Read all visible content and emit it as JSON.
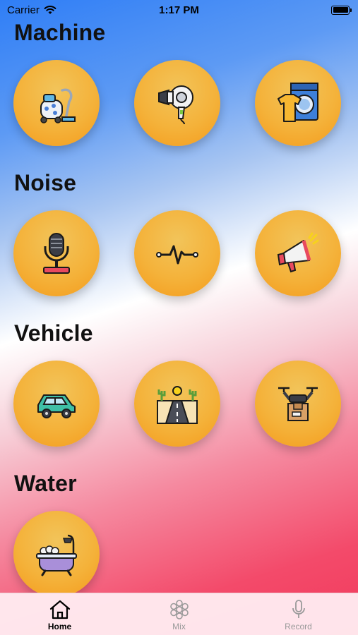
{
  "status_bar": {
    "carrier": "Carrier",
    "time": "1:17 PM"
  },
  "sections": [
    {
      "title": "Machine",
      "items": [
        "vacuum-cleaner-icon",
        "hair-dryer-icon",
        "washing-machine-icon"
      ]
    },
    {
      "title": "Noise",
      "items": [
        "microphone-icon",
        "heartbeat-icon",
        "megaphone-icon"
      ]
    },
    {
      "title": "Vehicle",
      "items": [
        "car-icon",
        "road-icon",
        "drone-icon"
      ]
    },
    {
      "title": "Water",
      "items": [
        "bathtub-icon"
      ]
    }
  ],
  "tab_bar": {
    "items": [
      {
        "label": "Home",
        "icon": "home-icon",
        "active": true
      },
      {
        "label": "Mix",
        "icon": "mix-icon",
        "active": false
      },
      {
        "label": "Record",
        "icon": "microphone-icon",
        "active": false
      }
    ]
  },
  "colors": {
    "button_fill": "#f4b23a",
    "tab_active": "#000000",
    "tab_inactive": "#9a9a9a",
    "gradient_top": "#2f7ef6",
    "gradient_bottom": "#f23a5c"
  }
}
